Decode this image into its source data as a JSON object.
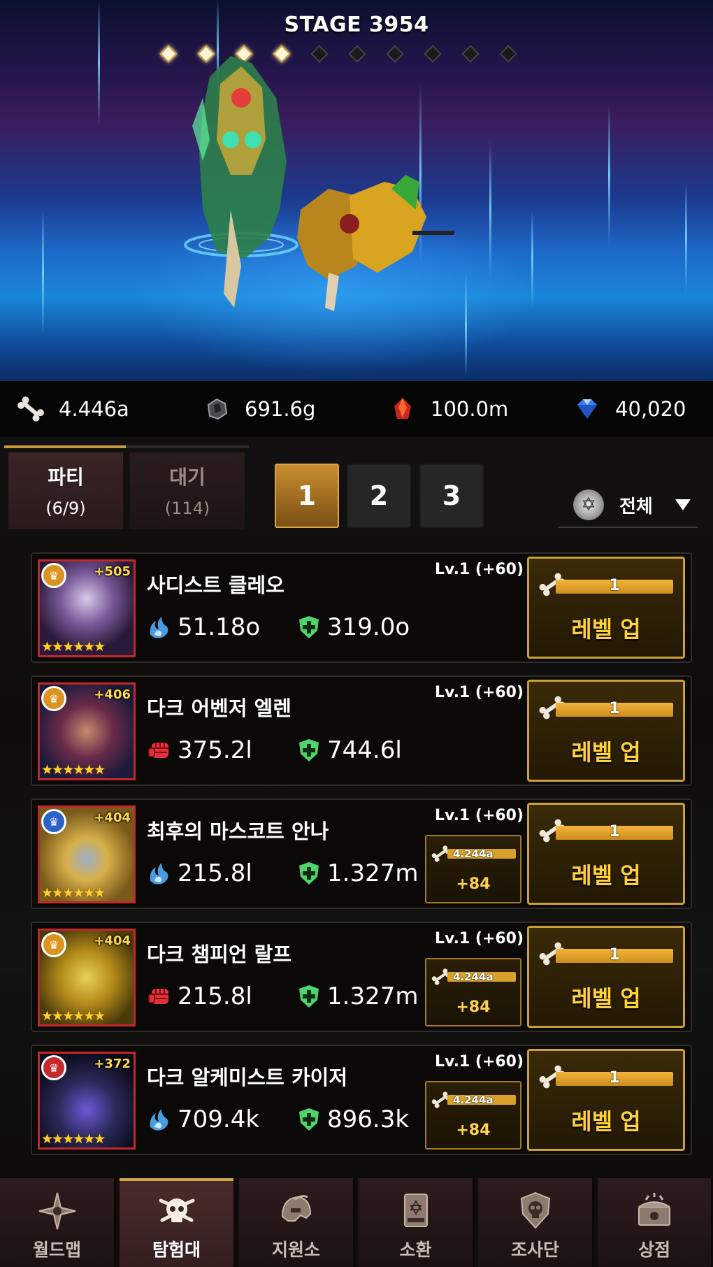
{
  "stage": {
    "title": "STAGE 3954",
    "waves_total": 10,
    "waves_cleared": 4
  },
  "resources": [
    {
      "icon": "bone-icon",
      "value": "4.446a"
    },
    {
      "icon": "ore-stone-icon",
      "value": "691.6g"
    },
    {
      "icon": "red-crystal-icon",
      "value": "100.0m"
    },
    {
      "icon": "diamond-gem-icon",
      "value": "40,020"
    }
  ],
  "tabs": {
    "party": {
      "label": "파티",
      "count": "(6/9)"
    },
    "wait": {
      "label": "대기",
      "count": "(114)"
    }
  },
  "slots": [
    "1",
    "2",
    "3"
  ],
  "active_slot": "1",
  "filter": {
    "label": "전체"
  },
  "heroes": [
    {
      "name": "사디스트 클레오",
      "plus": "+505",
      "stars": 6,
      "rank_color": "#d9951f",
      "level": "Lv.1 (+60)",
      "stat1_icon": "magic-power-icon",
      "stat1": "51.18o",
      "stat2": "319.0o",
      "cost": null,
      "cost_plus": null,
      "levelup_amount": "1",
      "levelup_label": "레벨 업"
    },
    {
      "name": "다크 어벤저 엘렌",
      "plus": "+406",
      "stars": 6,
      "rank_color": "#d9951f",
      "level": "Lv.1 (+60)",
      "stat1_icon": "fist-attack-icon",
      "stat1": "375.2l",
      "stat2": "744.6l",
      "cost": null,
      "cost_plus": null,
      "levelup_amount": "1",
      "levelup_label": "레벨 업"
    },
    {
      "name": "최후의 마스코트 안나",
      "plus": "+404",
      "stars": 6,
      "rank_color": "#2b63c9",
      "level": "Lv.1 (+60)",
      "stat1_icon": "magic-power-icon",
      "stat1": "215.8l",
      "stat2": "1.327m",
      "cost": "4.244a",
      "cost_plus": "+84",
      "levelup_amount": "1",
      "levelup_label": "레벨 업"
    },
    {
      "name": "다크 챔피언 랄프",
      "plus": "+404",
      "stars": 6,
      "rank_color": "#d9951f",
      "level": "Lv.1 (+60)",
      "stat1_icon": "fist-attack-icon",
      "stat1": "215.8l",
      "stat2": "1.327m",
      "cost": "4.244a",
      "cost_plus": "+84",
      "levelup_amount": "1",
      "levelup_label": "레벨 업"
    },
    {
      "name": "다크 알케미스트 카이저",
      "plus": "+372",
      "stars": 6,
      "rank_color": "#c42a2a",
      "level": "Lv.1 (+60)",
      "stat1_icon": "magic-power-icon",
      "stat1": "709.4k",
      "stat2": "896.3k",
      "cost": "4.244a",
      "cost_plus": "+84",
      "levelup_amount": "1",
      "levelup_label": "레벨 업"
    }
  ],
  "nav": [
    {
      "icon": "compass-star-icon",
      "label": "월드맵",
      "active": false
    },
    {
      "icon": "skull-emblem-icon",
      "label": "탐험대",
      "active": true
    },
    {
      "icon": "helmet-icon",
      "label": "지원소",
      "active": false
    },
    {
      "icon": "summon-card-icon",
      "label": "소환",
      "active": false
    },
    {
      "icon": "shield-skull-icon",
      "label": "조사단",
      "active": false
    },
    {
      "icon": "treasure-chest-icon",
      "label": "상점",
      "active": false
    }
  ]
}
